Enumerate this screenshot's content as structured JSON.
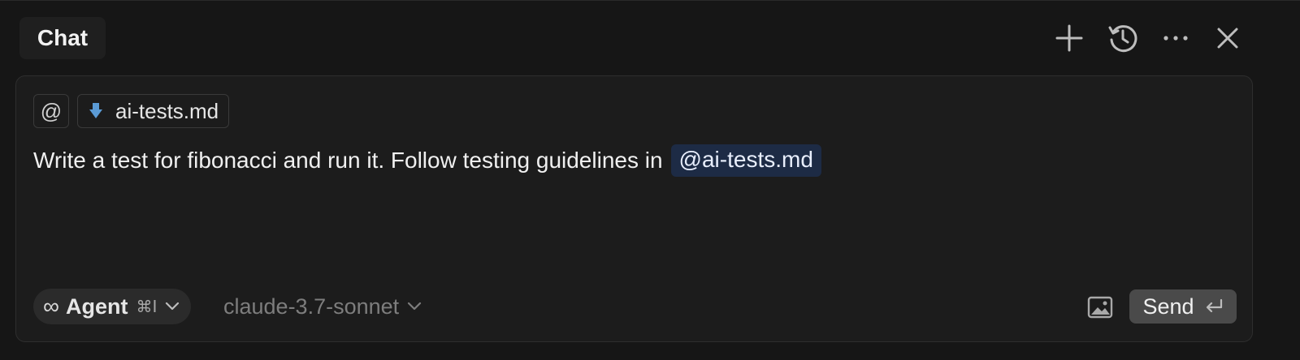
{
  "header": {
    "tab_label": "Chat",
    "icons": [
      "plus-icon",
      "history-icon",
      "more-icon",
      "close-icon"
    ]
  },
  "composer": {
    "at_symbol": "@",
    "file_chip": {
      "icon": "download-arrow-icon",
      "label": "ai-tests.md",
      "icon_color": "#5b9bd5"
    },
    "prompt_text": "Write a test for fibonacci and run it. Follow testing guidelines in",
    "mention_label": "@ai-tests.md",
    "mention_bg": "#1d2b45"
  },
  "toolbar": {
    "mode_icon": "∞",
    "mode_label": "Agent",
    "mode_shortcut": "⌘I",
    "model_label": "claude-3.7-sonnet",
    "send_label": "Send",
    "image_icon": "image-icon",
    "enter_icon": "enter-icon"
  }
}
